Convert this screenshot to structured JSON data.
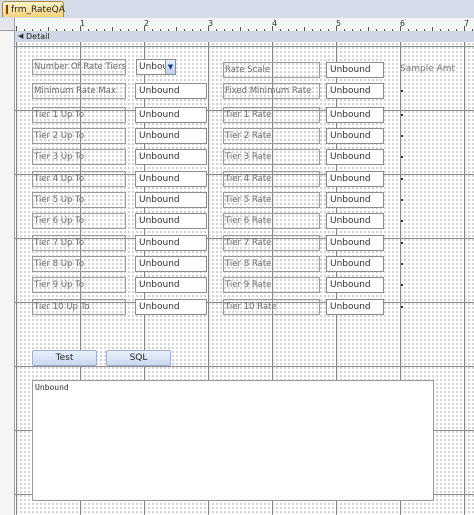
{
  "window": {
    "tab_title": "frm_RateQA"
  },
  "ruler": {
    "numbers": [
      "1",
      "2",
      "3",
      "4",
      "5",
      "6",
      "7"
    ]
  },
  "section": {
    "label": "Detail"
  },
  "form": {
    "num_tiers_label": "Number Of Rate Tiers:",
    "num_tiers_value": "Unbou",
    "min_rate_max_label": "Minimum Rate Max",
    "min_rate_max_value": "Unbound",
    "rate_scale_label": "Rate Scale",
    "rate_scale_value": "Unbound",
    "sample_amt_label": "Sample Amt",
    "fixed_min_rate_label": "Fixed Minimum Rate",
    "fixed_min_rate_value": "Unbound",
    "tiers": [
      {
        "up_to_label": "Tier 1 Up To",
        "up_to_value": "Unbound",
        "rate_label": "Tier 1 Rate",
        "rate_value": "Unbound"
      },
      {
        "up_to_label": "Tier 2 Up To",
        "up_to_value": "Unbound",
        "rate_label": "Tier 2 Rate",
        "rate_value": "Unbound"
      },
      {
        "up_to_label": "Tier 3 Up To",
        "up_to_value": "Unbound",
        "rate_label": "Tier 3 Rate",
        "rate_value": "Unbound"
      },
      {
        "up_to_label": "Tier 4 Up To",
        "up_to_value": "Unbound",
        "rate_label": "Tier 4 Rate",
        "rate_value": "Unbound"
      },
      {
        "up_to_label": "Tier 5 Up To",
        "up_to_value": "Unbound",
        "rate_label": "Tier 5 Rate",
        "rate_value": "Unbound"
      },
      {
        "up_to_label": "Tier 6 Up To",
        "up_to_value": "Unbound",
        "rate_label": "Tier 6 Rate",
        "rate_value": "Unbound"
      },
      {
        "up_to_label": "Tier 7 Up To",
        "up_to_value": "Unbound",
        "rate_label": "Tier 7 Rate",
        "rate_value": "Unbound"
      },
      {
        "up_to_label": "Tier 8 Up To",
        "up_to_value": "Unbound",
        "rate_label": "Tier 8 Rate",
        "rate_value": "Unbound"
      },
      {
        "up_to_label": "Tier 9 Up To",
        "up_to_value": "Unbound",
        "rate_label": "Tier 9 Rate",
        "rate_value": "Unbound"
      },
      {
        "up_to_label": "Tier 10 Up To",
        "up_to_value": "Unbound",
        "rate_label": "Tier 10 Rate",
        "rate_value": "Unbound"
      }
    ],
    "test_button": "Test",
    "sql_button": "SQL",
    "memo_value": "Unbound"
  },
  "colors": {
    "tab_accent": "#f7d37c",
    "section_bar": "#cfd7e6",
    "button_fill": "#c9d9f1"
  },
  "icons": {
    "tab": "form-icon",
    "section": "section-collapse-icon",
    "combo": "dropdown-arrow-icon"
  }
}
